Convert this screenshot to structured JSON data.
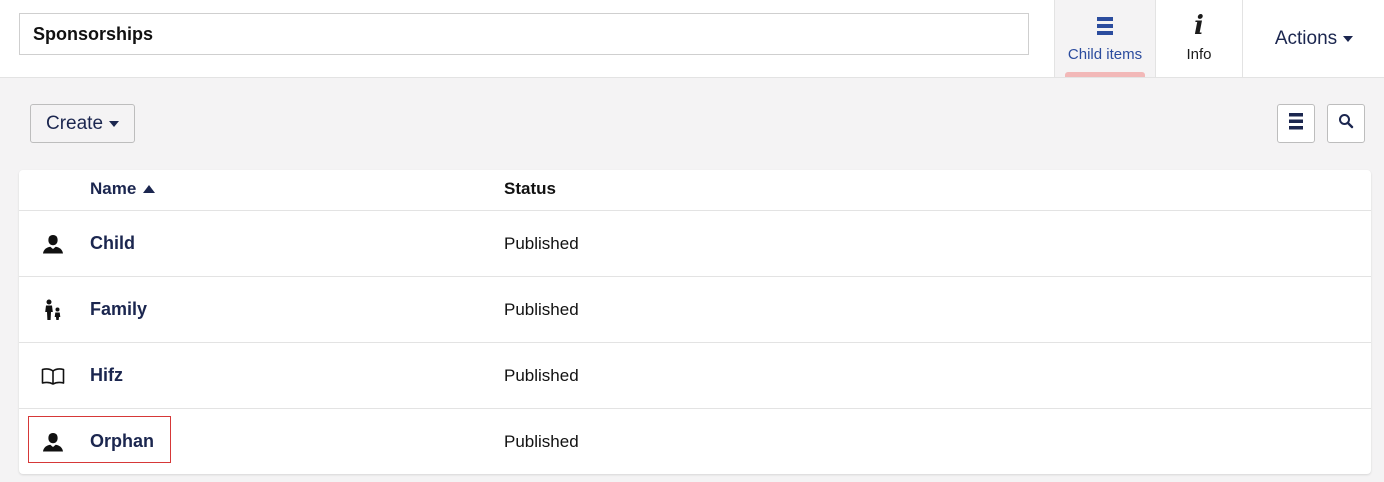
{
  "header": {
    "title_value": "Sponsorships",
    "tabs": [
      {
        "label": "Child items",
        "icon": "list-icon",
        "active": true
      },
      {
        "label": "Info",
        "icon": "info-icon",
        "active": false
      }
    ],
    "actions_label": "Actions"
  },
  "toolbar": {
    "create_label": "Create",
    "view_toggle_icon": "list-icon",
    "search_icon": "search-icon"
  },
  "table": {
    "columns": [
      "Name",
      "Status"
    ],
    "sort": {
      "column": "Name",
      "direction": "ascending"
    },
    "rows": [
      {
        "icon": "person-icon",
        "name": "Child",
        "status": "Published"
      },
      {
        "icon": "family-icon",
        "name": "Family",
        "status": "Published"
      },
      {
        "icon": "book-icon",
        "name": "Hifz",
        "status": "Published"
      },
      {
        "icon": "person-icon",
        "name": "Orphan",
        "status": "Published"
      }
    ]
  },
  "colors": {
    "accent": "#2b4c9e",
    "text_primary": "#1b264f",
    "tab_indicator": "#f2b8b8",
    "focus_outline": "#d63838",
    "background": "#f4f3f4"
  }
}
